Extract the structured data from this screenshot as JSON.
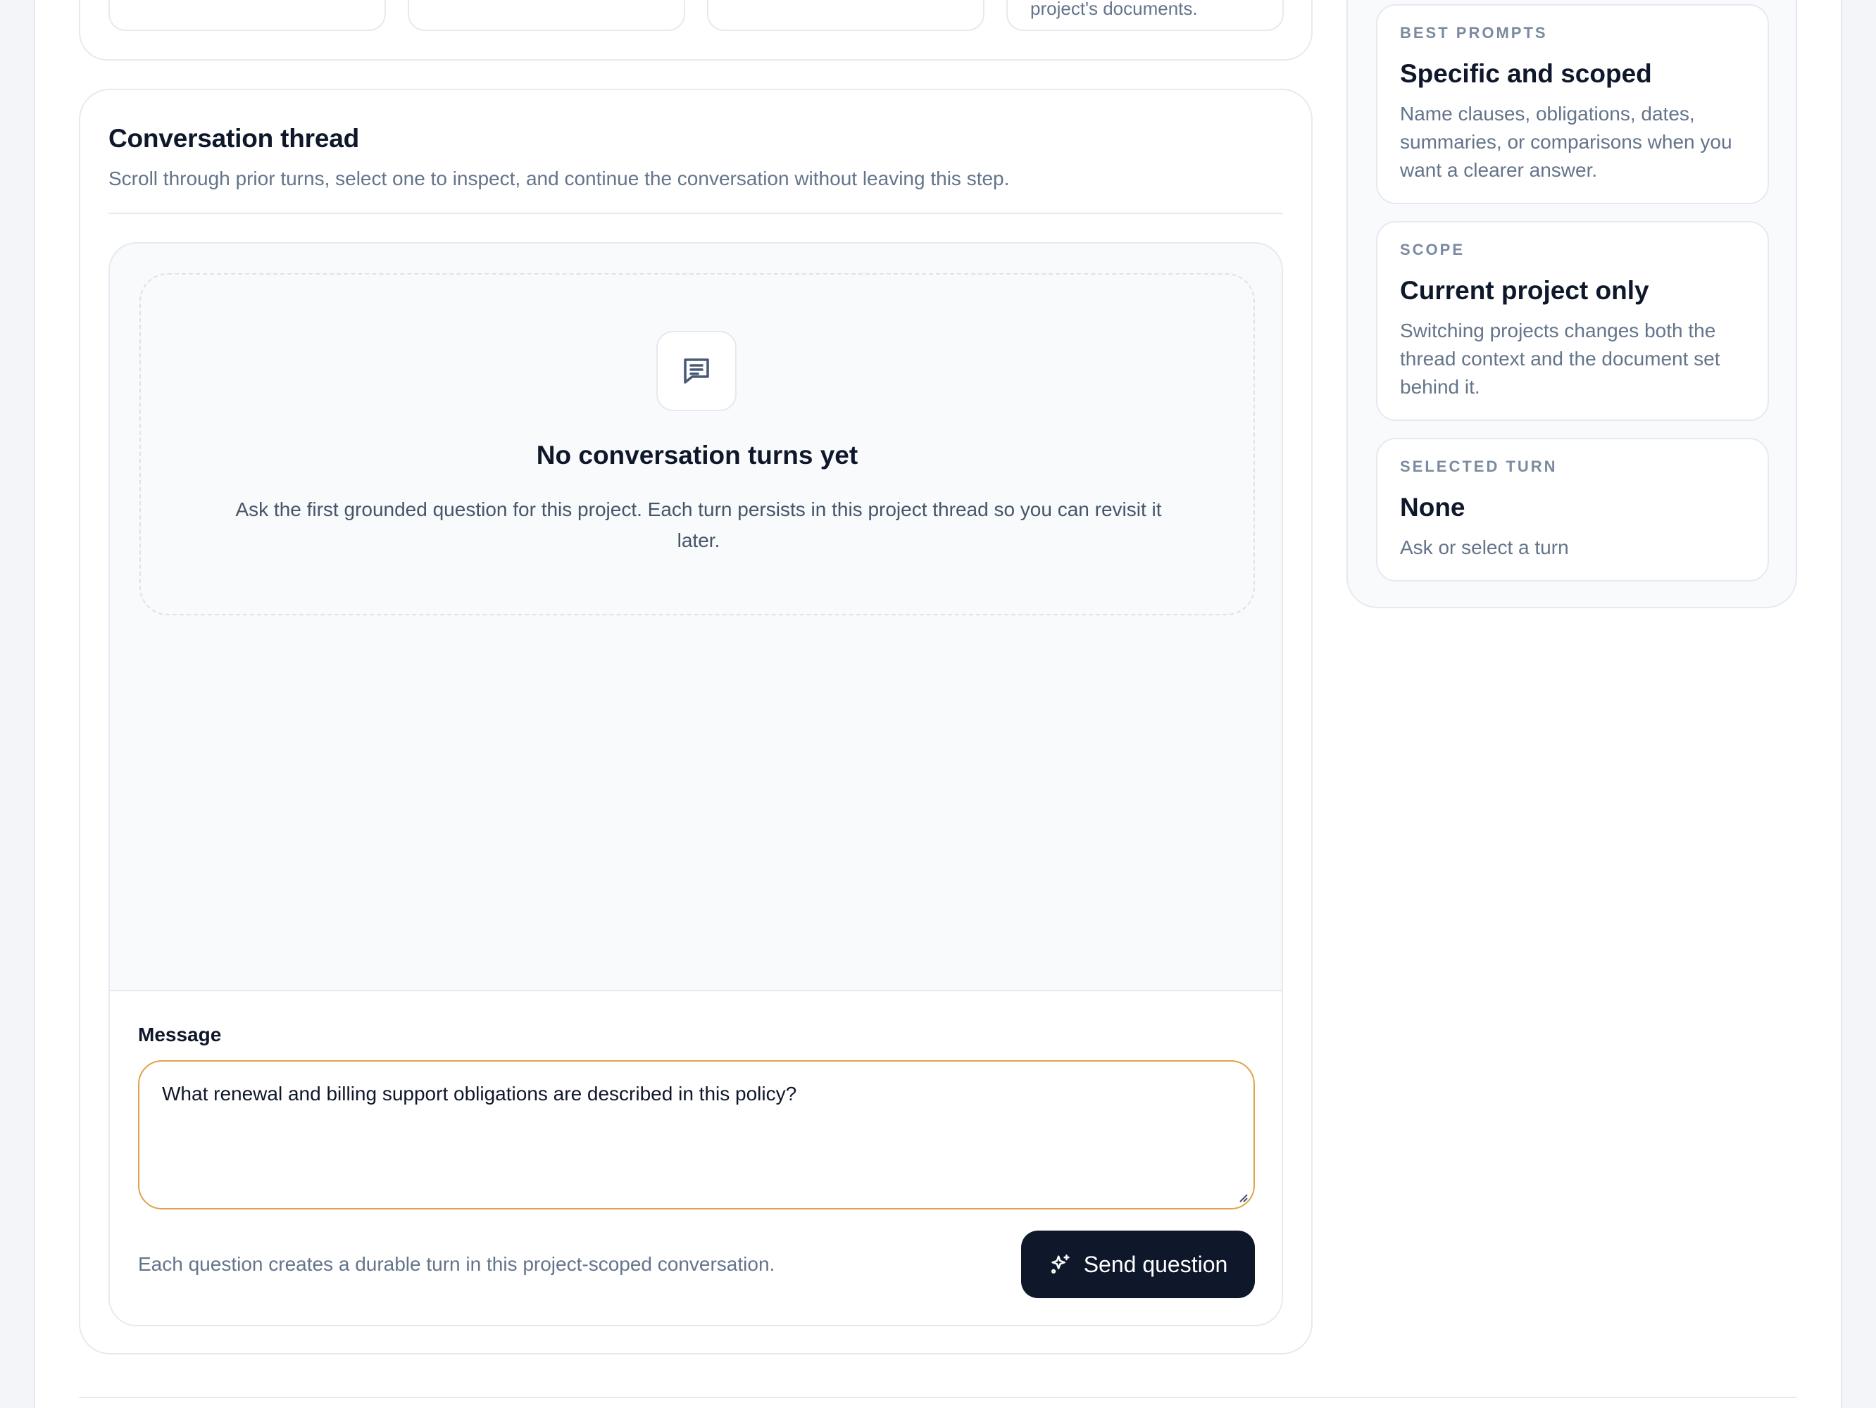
{
  "top_cards": {
    "card4_text": "project's documents."
  },
  "conversation": {
    "title": "Conversation thread",
    "subtitle": "Scroll through prior turns, select one to inspect, and continue the conversation without leaving this step.",
    "empty": {
      "icon": "message-square-icon",
      "title": "No conversation turns yet",
      "description": "Ask the first grounded question for this project. Each turn persists in this project thread so you can revisit it later."
    },
    "composer": {
      "label": "Message",
      "value": "What renewal and billing support obligations are described in this policy?",
      "note": "Each question creates a durable turn in this project-scoped conversation.",
      "send_label": "Send question",
      "send_icon": "sparkles-icon"
    }
  },
  "side_panel": {
    "cards": [
      {
        "kicker": "BEST PROMPTS",
        "title": "Specific and scoped",
        "body": "Name clauses, obligations, dates, summaries, or comparisons when you want a clearer answer."
      },
      {
        "kicker": "SCOPE",
        "title": "Current project only",
        "body": "Switching projects changes both the thread context and the document set behind it."
      },
      {
        "kicker": "SELECTED TURN",
        "title": "None",
        "body": "Ask or select a turn"
      }
    ]
  },
  "colors": {
    "accent_border": "#e0a24a",
    "primary_button": "#0f172a",
    "muted_text": "#64748b"
  }
}
